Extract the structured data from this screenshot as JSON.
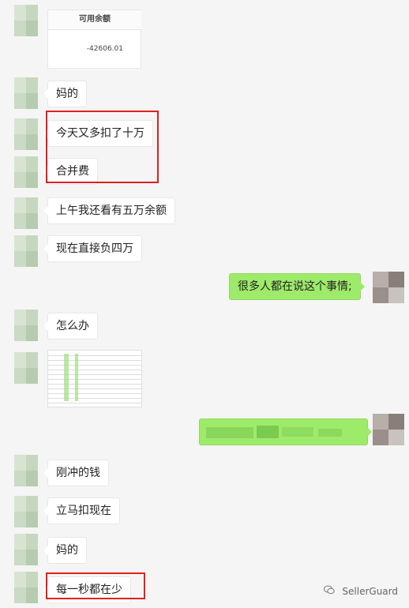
{
  "card": {
    "header": "可用余额",
    "value": "-42606.01"
  },
  "messages": [
    {
      "id": "m1",
      "text": "妈的"
    },
    {
      "id": "m2",
      "text": "今天又多扣了十万"
    },
    {
      "id": "m3",
      "text": "合并费"
    },
    {
      "id": "m4",
      "text": "上午我还看有五万余额"
    },
    {
      "id": "m5",
      "text": "现在直接负四万"
    },
    {
      "id": "m6",
      "text": "很多人都在说这个事情;"
    },
    {
      "id": "m7",
      "text": "怎么办"
    },
    {
      "id": "m8",
      "text": "刚冲的钱"
    },
    {
      "id": "m9",
      "text": "立马扣现在"
    },
    {
      "id": "m10",
      "text": "妈的"
    },
    {
      "id": "m11",
      "text": "每一秒都在少"
    }
  ],
  "watermark": {
    "icon": "wechat-icon",
    "text": "SellerGuard"
  },
  "colors": {
    "background": "#f5f5f5",
    "bubble_received": "#ffffff",
    "bubble_sent": "#9eea6a",
    "highlight_box": "#e02020"
  }
}
